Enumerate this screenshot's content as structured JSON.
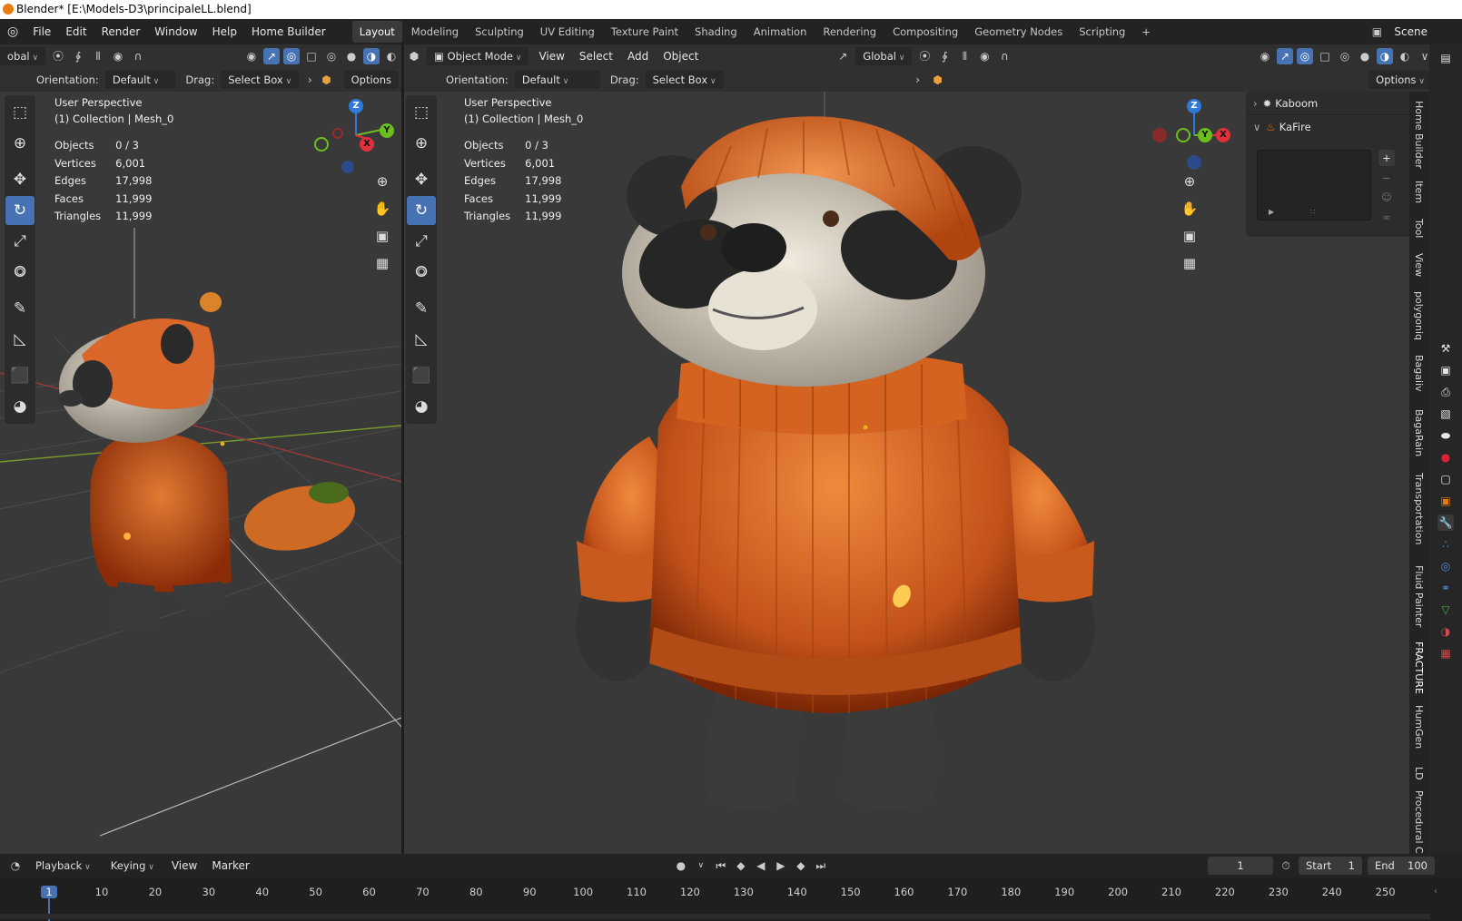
{
  "window": {
    "title": "Blender* [E:\\Models-D3\\principaleLL.blend]"
  },
  "menu": {
    "items": [
      "File",
      "Edit",
      "Render",
      "Window",
      "Help",
      "Home Builder"
    ]
  },
  "workspaces": [
    "Layout",
    "Modeling",
    "Sculpting",
    "UV Editing",
    "Texture Paint",
    "Shading",
    "Animation",
    "Rendering",
    "Compositing",
    "Geometry Nodes",
    "Scripting"
  ],
  "add_workspace": "+",
  "scene": {
    "label": "Scene"
  },
  "left_view": {
    "transform_space": "obal",
    "orientation_label": "Orientation:",
    "orientation_value": "Default",
    "drag_label": "Drag:",
    "drag_value": "Select Box",
    "options": "Options",
    "persp": "User Perspective",
    "collection": "(1) Collection | Mesh_0"
  },
  "right_view": {
    "mode": "Object Mode",
    "menu": [
      "View",
      "Select",
      "Add",
      "Object"
    ],
    "transform_space": "Global",
    "orientation_label": "Orientation:",
    "orientation_value": "Default",
    "drag_label": "Drag:",
    "drag_value": "Select Box",
    "options": "Options",
    "persp": "User Perspective",
    "collection": "(1) Collection | Mesh_0"
  },
  "stats": [
    {
      "k": "Objects",
      "v": "0 / 3"
    },
    {
      "k": "Vertices",
      "v": "6,001"
    },
    {
      "k": "Edges",
      "v": "17,998"
    },
    {
      "k": "Faces",
      "v": "11,999"
    },
    {
      "k": "Triangles",
      "v": "11,999"
    }
  ],
  "gizmo": {
    "z": "Z",
    "y": "Y",
    "x": "X"
  },
  "npanel": {
    "panels": [
      {
        "name": "Kaboom",
        "expanded": false
      },
      {
        "name": "KaFire",
        "expanded": true
      }
    ],
    "add": "+",
    "remove": "−"
  },
  "side_tabs": [
    "Home Builder",
    "Item",
    "Tool",
    "View",
    "polygoniq",
    "Bagaiiv",
    "BagaRain",
    "Transportation",
    "Fluid Painter",
    "FRACTURE",
    "HumGen",
    "LD",
    "Procedural Crc"
  ],
  "timeline": {
    "menu": [
      "Playback",
      "Keying",
      "View",
      "Marker"
    ],
    "current_frame": "1",
    "start_label": "Start",
    "start": "1",
    "end_label": "End",
    "end": "100",
    "ticks": [
      "1",
      "10",
      "20",
      "30",
      "40",
      "50",
      "60",
      "70",
      "80",
      "90",
      "100",
      "110",
      "120",
      "130",
      "140",
      "150",
      "160",
      "170",
      "180",
      "190",
      "200",
      "210",
      "220",
      "230",
      "240",
      "250"
    ]
  },
  "colors": {
    "accent": "#4772b3",
    "orange": "#e8601c",
    "x_axis": "#e0303c",
    "y_axis": "#6bbf1c",
    "z_axis": "#2f7ad8"
  }
}
